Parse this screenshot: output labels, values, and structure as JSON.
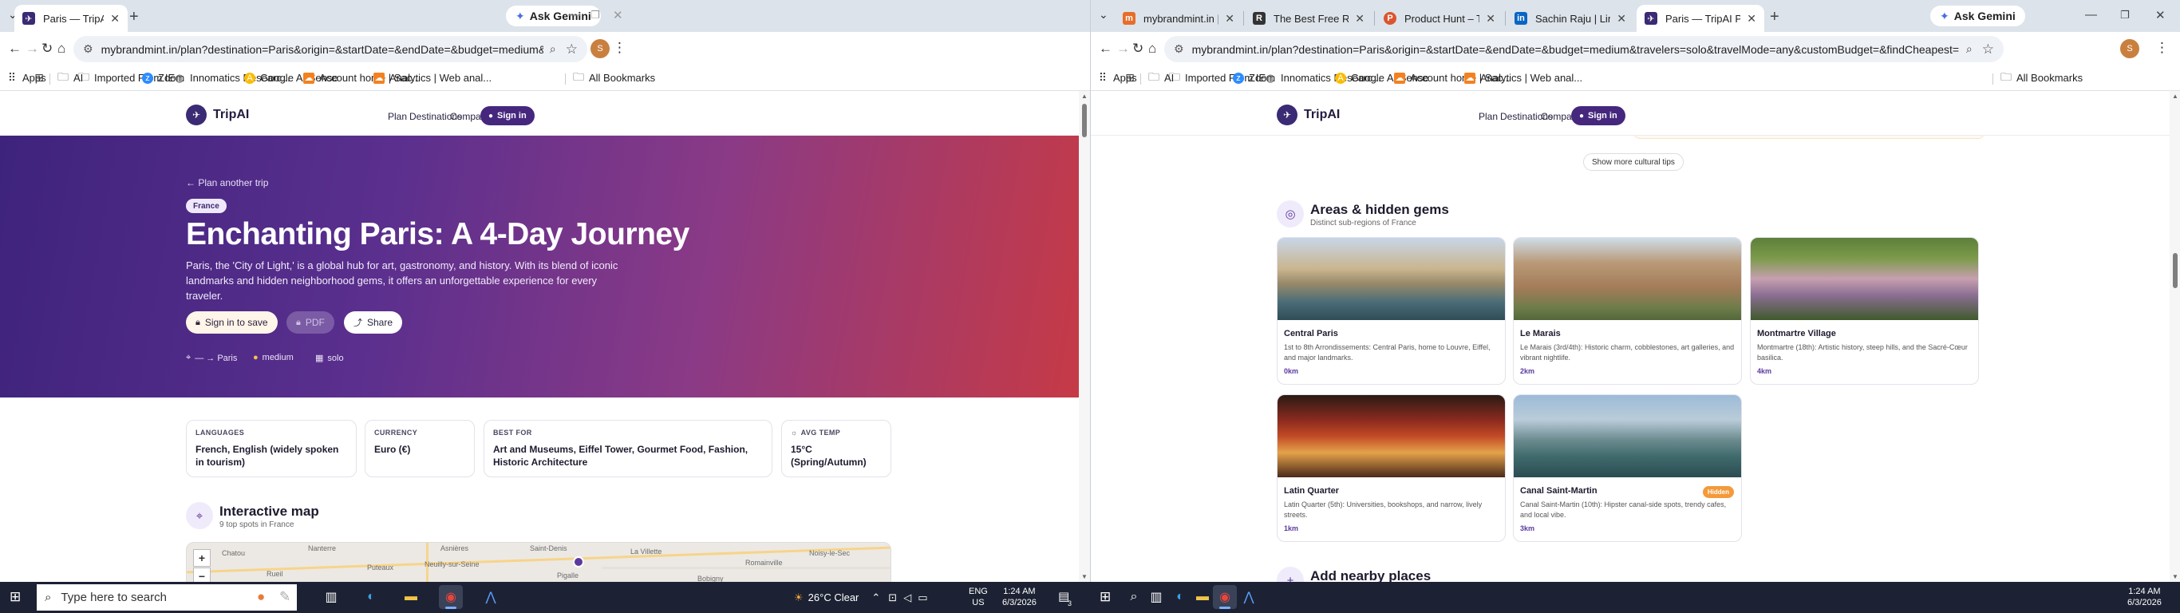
{
  "win1": {
    "tabs": [
      {
        "title": "Paris — TripAI Plan"
      }
    ],
    "gemini": "Ask Gemini",
    "url": "mybrandmint.in/plan?destination=Paris&origin=&startDate=&endDate=&budget=medium&travelers=solo&travelMode=any&customBudget=&findCheapest=",
    "avatar": "S"
  },
  "win2": {
    "tabs": [
      {
        "title": "mybrandmint.in | mybr",
        "fav": "#e76d2a"
      },
      {
        "title": "The Best Free RoamAr",
        "fav": "#333333"
      },
      {
        "title": "Product Hunt – The be",
        "fav": "#da552f"
      },
      {
        "title": "Sachin Raju | LinkedIn",
        "fav": "#0a66c2"
      },
      {
        "title": "Paris — TripAI Plan",
        "fav": "#3b2a74"
      }
    ],
    "gemini": "Ask Gemini",
    "url": "mybrandmint.in/plan?destination=Paris&origin=&startDate=&endDate=&budget=medium&travelers=solo&travelMode=any&customBudget=&findCheapest=",
    "avatar": "S"
  },
  "bookmarks": {
    "apps": "Apps",
    "ai": "AI",
    "imported": "Imported From IE",
    "zoom": "Zoom",
    "innomatics": "Innomatics Researc...",
    "adsense": "Google AdSense",
    "account": "Account home | Sac...",
    "analytics": "Analytics | Web anal...",
    "all": "All Bookmarks"
  },
  "site": {
    "brand": "TripAI",
    "nav": [
      "Plan",
      "Destinations",
      "Compare"
    ],
    "signin": "Sign in"
  },
  "hero": {
    "back": "← Plan another trip",
    "chip": "France",
    "title": "Enchanting Paris: A 4-Day Journey",
    "desc": "Paris, the 'City of Light,' is a global hub for art, gastronomy, and history. With its blend of iconic landmarks and hidden neighborhood gems, it offers an unforgettable experience for every traveler.",
    "save": "Sign in to save",
    "pdf": "PDF",
    "share": "Share",
    "route": "— → Paris",
    "budget": "medium",
    "travelers": "solo"
  },
  "facts": [
    {
      "label": "LANGUAGES",
      "value": "French, English (widely spoken in tourism)"
    },
    {
      "label": "CURRENCY",
      "value": "Euro (€)"
    },
    {
      "label": "BEST FOR",
      "value": "Art and Museums, Eiffel Tower, Gourmet Food, Fashion, Historic Architecture"
    },
    {
      "label": "AVG TEMP",
      "value": "15°C (Spring/Autumn)"
    }
  ],
  "map": {
    "title": "Interactive map",
    "sub": "9 top spots in France",
    "labels": [
      "Chatou",
      "Nanterre",
      "Asnières",
      "Neuilly-sur-Seine",
      "Saint-Denis",
      "La Villette",
      "Romainville",
      "Noisy-le-Sec",
      "Puteaux",
      "Rueil",
      "Pigalle",
      "Bobigny"
    ]
  },
  "tips": "Show more cultural tips",
  "areas": {
    "title": "Areas & hidden gems",
    "sub": "Distinct sub-regions of France",
    "items": [
      {
        "name": "Central Paris",
        "desc": "1st to 8th Arrondissements: Central Paris, home to Louvre, Eiffel, and major landmarks.",
        "dist": "0km",
        "badge": ""
      },
      {
        "name": "Le Marais",
        "desc": "Le Marais (3rd/4th): Historic charm, cobblestones, art galleries, and vibrant nightlife.",
        "dist": "2km",
        "badge": ""
      },
      {
        "name": "Montmartre Village",
        "desc": "Montmartre (18th): Artistic history, steep hills, and the Sacré-Cœur basilica.",
        "dist": "4km",
        "badge": ""
      },
      {
        "name": "Latin Quarter",
        "desc": "Latin Quarter (5th): Universities, bookshops, and narrow, lively streets.",
        "dist": "1km",
        "badge": ""
      },
      {
        "name": "Canal Saint-Martin",
        "desc": "Canal Saint-Martin (10th): Hipster canal-side spots, trendy cafes, and local vibe.",
        "dist": "3km",
        "badge": "Hidden"
      }
    ]
  },
  "nearby": "Add nearby places",
  "taskbar": {
    "search": "Type here to search",
    "weather": "26°C  Clear",
    "lang": "ENG",
    "region": "US",
    "time": "1:24 AM",
    "date": "6/3/2026",
    "notif": "3"
  },
  "colors": {
    "accent": "#46277e",
    "hidden": "#f39a3a",
    "hero_start": "#3e237c",
    "hero_end": "#c63a46"
  }
}
